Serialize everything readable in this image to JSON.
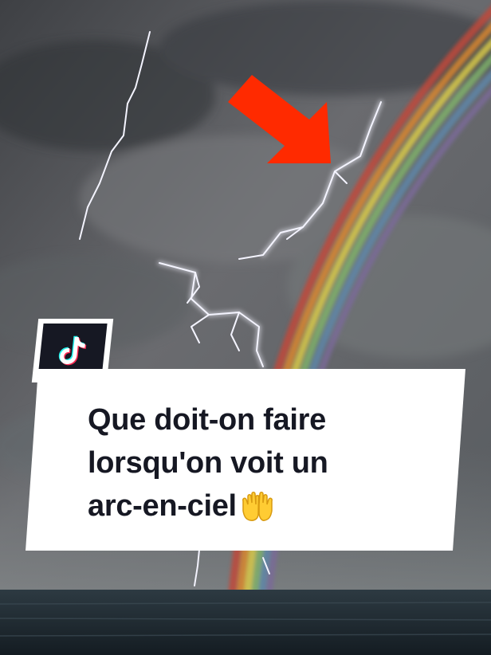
{
  "caption": {
    "line1": "Que doit-on faire",
    "line2": "lorsqu'on voit un",
    "line3": "arc-en-ciel"
  },
  "badge": {
    "icon": "tiktok-logo-icon"
  },
  "emoji": {
    "icon": "palms-up-together-icon"
  },
  "annotation": {
    "icon": "red-arrow-icon",
    "color": "#ff2a00"
  },
  "colors": {
    "caption_bg": "#ffffff",
    "caption_text": "#161823",
    "badge_bg": "#161823"
  }
}
